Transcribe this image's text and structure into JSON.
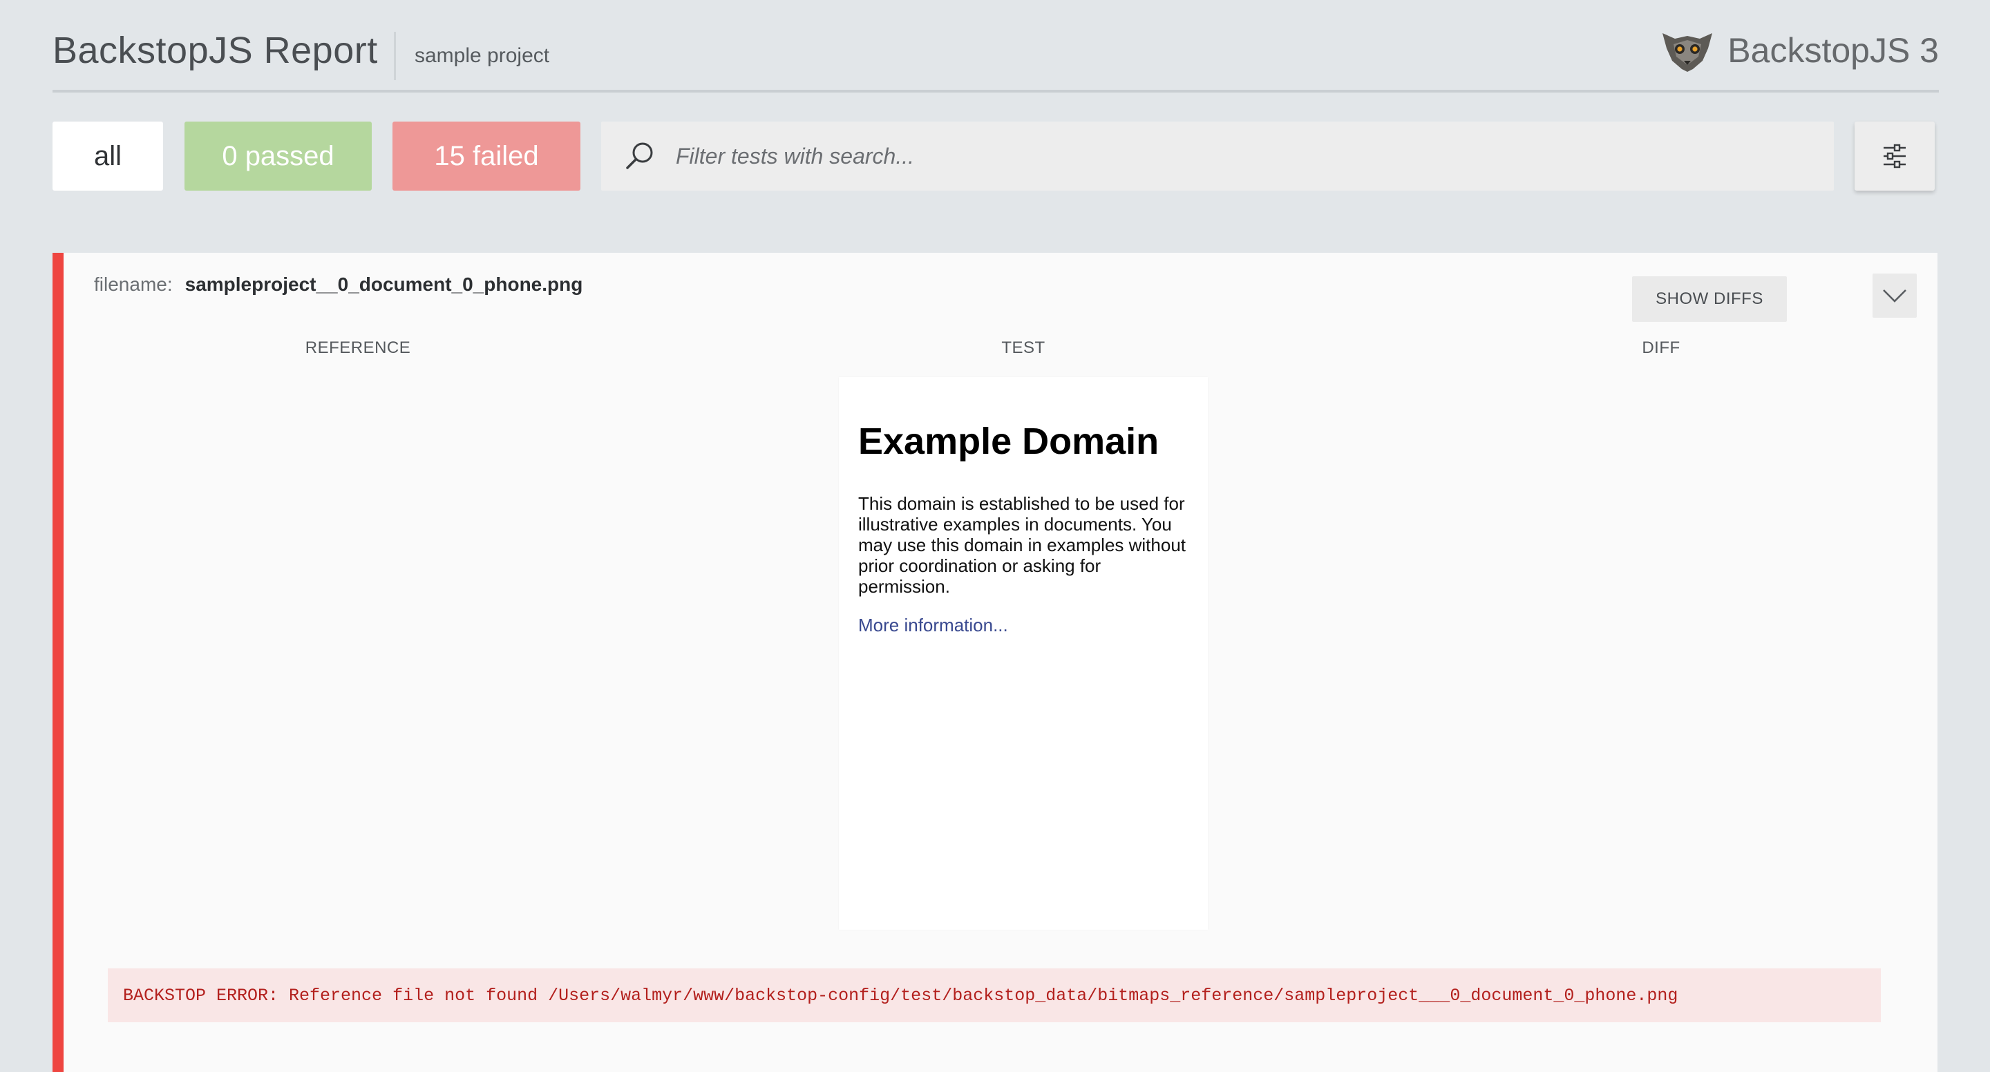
{
  "header": {
    "title": "BackstopJS Report",
    "project": "sample project",
    "brand_name": "BackstopJS 3",
    "brand_icon": "lemur-logo-icon"
  },
  "toolbar": {
    "all_label": "all",
    "passed_label": "0 passed",
    "failed_label": "15 failed",
    "search_placeholder": "Filter tests with search...",
    "search_icon": "search-icon",
    "settings_icon": "sliders-icon"
  },
  "test": {
    "filename_label": "filename:",
    "filename": "sampleproject__0_document_0_phone.png",
    "show_diffs_label": "SHOW DIFFS",
    "collapse_icon": "chevron-down-icon",
    "columns": {
      "reference": "REFERENCE",
      "test": "TEST",
      "diff": "DIFF"
    },
    "test_image": {
      "heading": "Example Domain",
      "paragraph": "This domain is established to be used for illustrative examples in documents. You may use this domain in examples without prior coordination or asking for permission.",
      "link": "More information..."
    },
    "error": "BACKSTOP ERROR: Reference file not found /Users/walmyr/www/backstop-config/test/backstop_data/bitmaps_reference/sampleproject___0_document_0_phone.png"
  },
  "colors": {
    "background": "#e2e6e9",
    "passed": "#b5d79e",
    "failed": "#ee9897",
    "fail_border": "#ee4540",
    "error_text": "#b3201d",
    "error_bg": "#f9e6e6"
  }
}
